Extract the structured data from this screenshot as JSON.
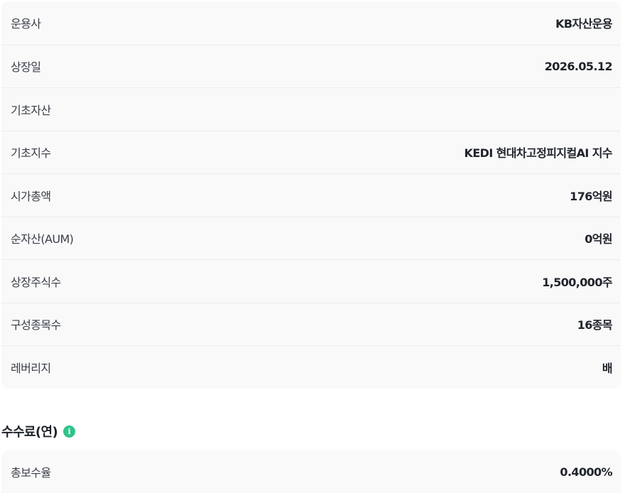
{
  "info_table": {
    "rows": [
      {
        "label": "운용사",
        "value": "KB자산운용"
      },
      {
        "label": "상장일",
        "value": "2026.05.12"
      },
      {
        "label": "기초자산",
        "value": ""
      },
      {
        "label": "기초지수",
        "value": "KEDI 현대차고정피지컬AI 지수"
      },
      {
        "label": "시가총액",
        "value": "176억원"
      },
      {
        "label": "순자산(AUM)",
        "value": "0억원"
      },
      {
        "label": "상장주식수",
        "value": "1,500,000주"
      },
      {
        "label": "구성종목수",
        "value": "16종목"
      },
      {
        "label": "레버리지",
        "value": "배"
      }
    ]
  },
  "fee_section": {
    "title": "수수료(연)",
    "info_icon": "info-icon",
    "info_glyph": "i",
    "rows": [
      {
        "label": "총보수율",
        "value": "0.4000%"
      }
    ]
  },
  "colors": {
    "card_bg": "#f9f9fa",
    "divider": "#ececee",
    "accent_green": "#2fc38a",
    "text_primary": "#1f232a"
  }
}
